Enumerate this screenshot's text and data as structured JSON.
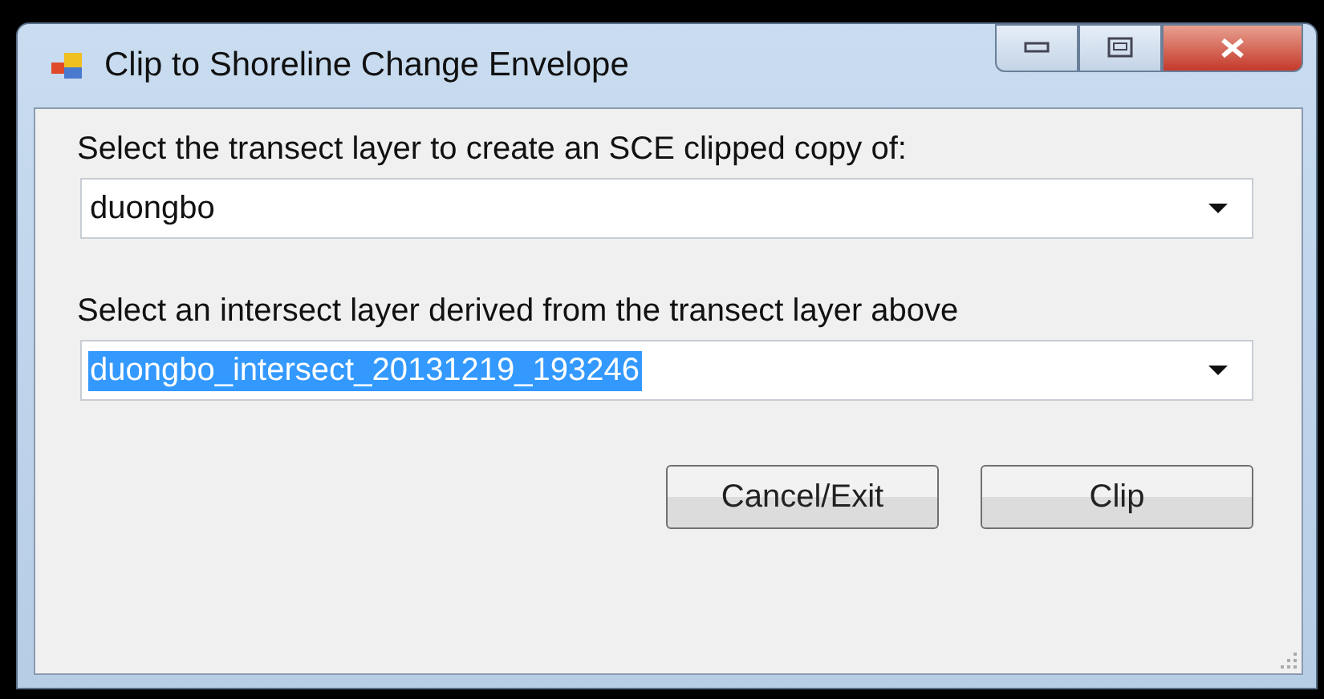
{
  "window": {
    "title": "Clip to Shoreline Change Envelope"
  },
  "fields": [
    {
      "label": "Select the transect layer to create an SCE clipped copy of:",
      "value": "duongbo",
      "text_selected": false
    },
    {
      "label": "Select an intersect layer derived from the transect layer above",
      "value": "duongbo_intersect_20131219_193246",
      "text_selected": true
    }
  ],
  "buttons": [
    "Cancel/Exit",
    "Clip"
  ]
}
